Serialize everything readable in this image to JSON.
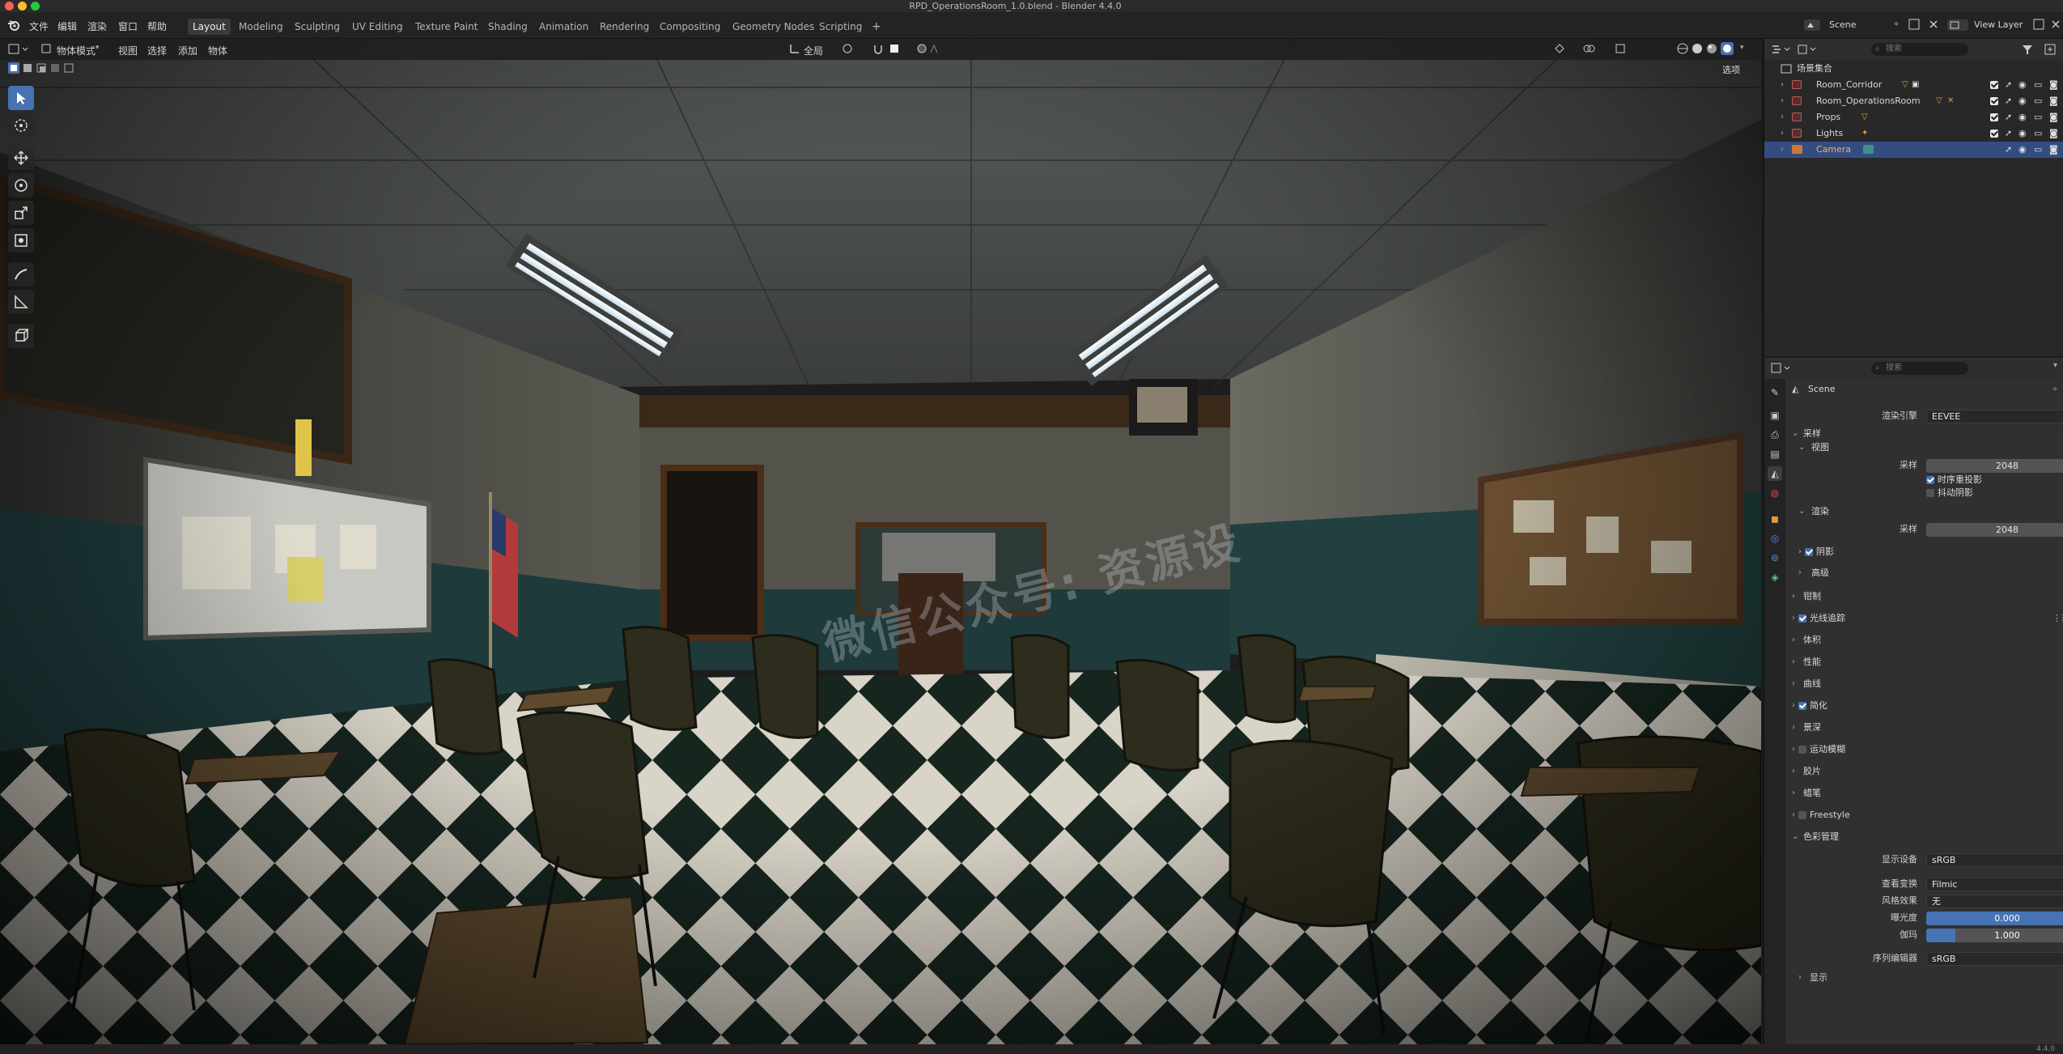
{
  "window": {
    "title": "RPD_OperationsRoom_1.0.blend - Blender 4.4.0"
  },
  "menu": {
    "items": [
      "文件",
      "编辑",
      "渲染",
      "窗口",
      "帮助"
    ]
  },
  "workspaces": [
    {
      "label": "Layout",
      "active": true
    },
    {
      "label": "Modeling"
    },
    {
      "label": "Sculpting"
    },
    {
      "label": "UV Editing"
    },
    {
      "label": "Texture Paint"
    },
    {
      "label": "Shading"
    },
    {
      "label": "Animation"
    },
    {
      "label": "Rendering"
    },
    {
      "label": "Compositing"
    },
    {
      "label": "Geometry Nodes"
    },
    {
      "label": "Scripting"
    }
  ],
  "scene_selector": {
    "label": "Scene"
  },
  "view_layer": {
    "label": "View Layer"
  },
  "viewport_header": {
    "mode": "物体模式",
    "menus": [
      "视图",
      "选择",
      "添加",
      "物体"
    ],
    "transform_orientation": "全局",
    "options": "选项"
  },
  "watermark": "微信公众号: 资源设",
  "outliner": {
    "search_placeholder": "搜索",
    "root": "场景集合",
    "items": [
      {
        "name": "Room_Corridor",
        "selected": false
      },
      {
        "name": "Room_OperationsRoom",
        "selected": false
      },
      {
        "name": "Props",
        "selected": false
      },
      {
        "name": "Lights",
        "selected": false
      },
      {
        "name": "Camera",
        "selected": true
      }
    ]
  },
  "properties": {
    "search_placeholder": "搜索",
    "context": "Scene",
    "render_engine_label": "渲染引擎",
    "render_engine": "EEVEE",
    "sampling": {
      "title": "采样",
      "viewport_title": "视图",
      "samples_label": "采样",
      "viewport_samples": "2048",
      "temporal_reprojection": "时序重投影",
      "jitter_shadows": "抖动阴影",
      "render_title": "渲染",
      "render_samples": "2048",
      "shadows": "阴影",
      "advanced": "高级"
    },
    "panels": {
      "clamping": "钳制",
      "raytracing": "光线追踪",
      "volumes": "体积",
      "performance": "性能",
      "curves": "曲线",
      "simplify": "简化",
      "depth_of_field": "景深",
      "motion_blur": "运动模糊",
      "film": "胶片",
      "grease_pencil": "蜡笔",
      "freestyle": "Freestyle",
      "color_management": "色彩管理"
    },
    "color_management": {
      "display_device_label": "显示设备",
      "display_device": "sRGB",
      "view_transform_label": "查看变换",
      "view_transform": "Filmic",
      "look_label": "风格效果",
      "look": "无",
      "exposure_label": "曝光度",
      "exposure": "0.000",
      "gamma_label": "伽玛",
      "gamma": "1.000",
      "sequencer_label": "序列编辑器",
      "sequencer": "sRGB",
      "display": "显示"
    }
  },
  "status": {
    "version": "4.4.0"
  }
}
